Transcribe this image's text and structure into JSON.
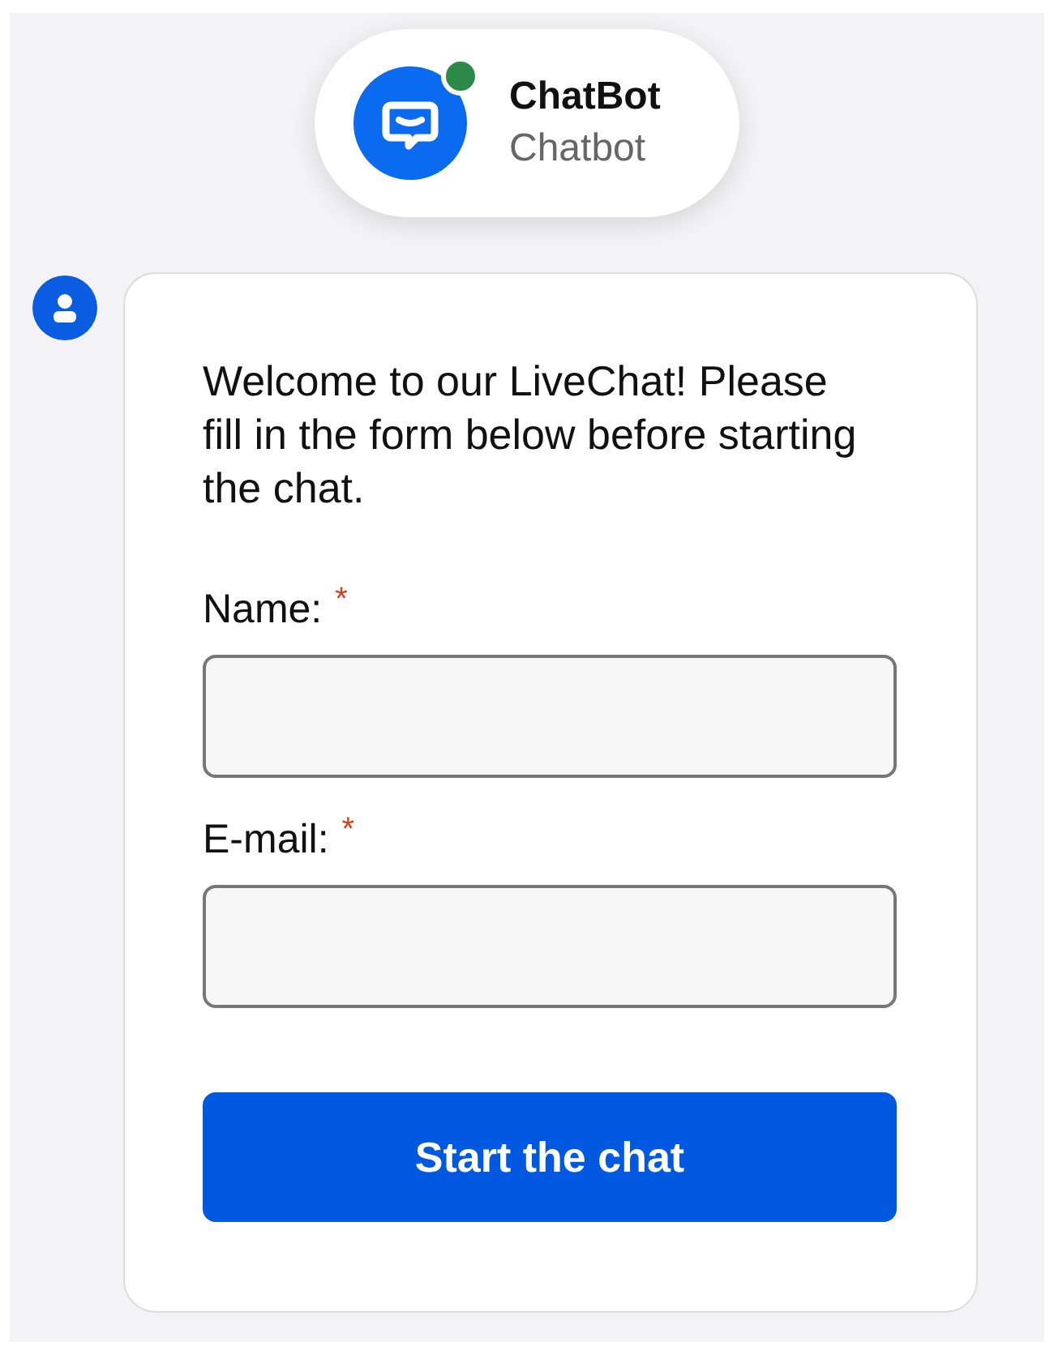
{
  "header": {
    "name": "ChatBot",
    "subtitle": "Chatbot",
    "online": true
  },
  "message": {
    "text": "Welcome to our LiveChat! Please fill in the form below before starting the chat.",
    "fields": [
      {
        "label": "Name:",
        "required_mark": "*"
      },
      {
        "label": "E-mail:",
        "required_mark": "*"
      }
    ],
    "button": "Start the chat"
  }
}
